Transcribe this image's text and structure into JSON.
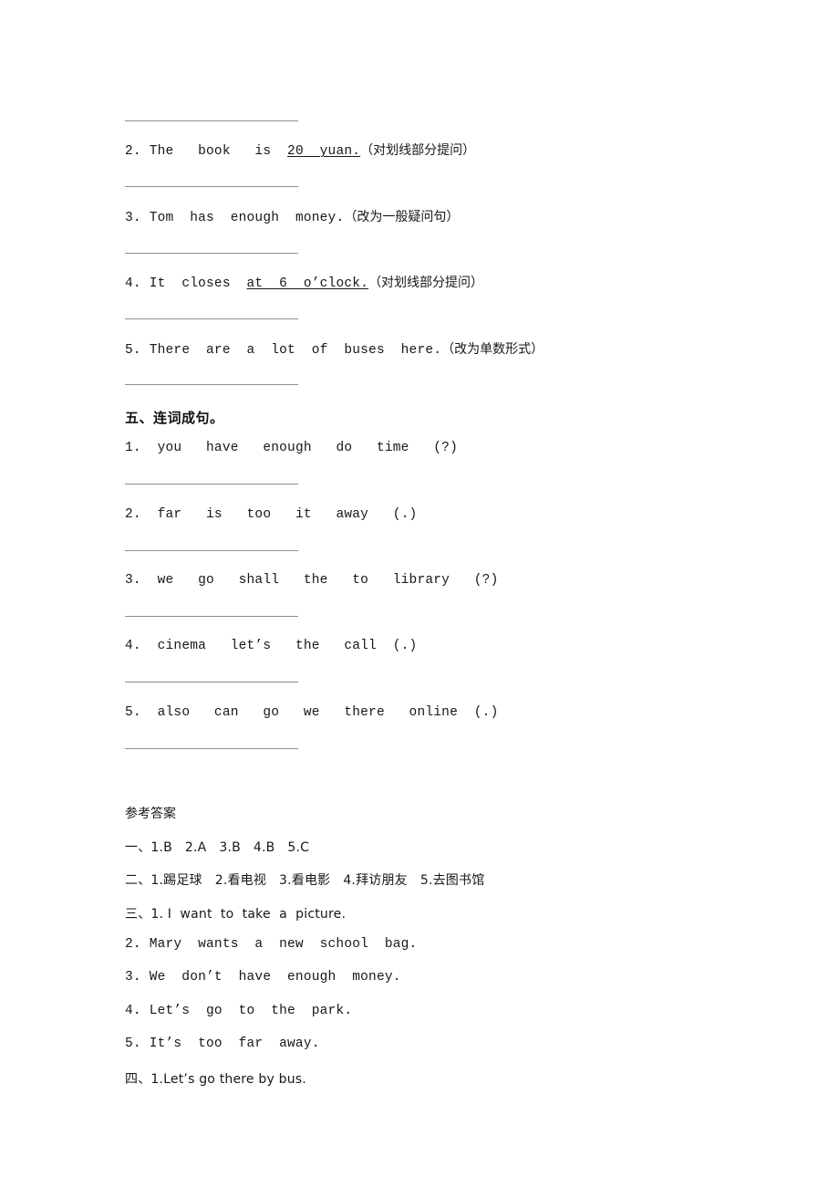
{
  "page": {
    "background": "#ffffff",
    "text_color": "#171717",
    "rule_color": "#8e8e8e"
  },
  "top_partial_blank": {
    "name": "answer-blank-rule"
  },
  "exercise_four_remaining": {
    "items": [
      {
        "number": "2.",
        "sentence_before": " The   book   is  ",
        "underlined": "20  yuan.",
        "instruction": "（对划线部分提问）"
      },
      {
        "number": "3.",
        "sentence_plain": " Tom  has  enough  money.",
        "instruction": "（改为一般疑问句）"
      },
      {
        "number": "4.",
        "sentence_before": " It  closes  ",
        "underlined": "at  6  o’clock.",
        "instruction": "（对划线部分提问）"
      },
      {
        "number": "5.",
        "sentence_plain": " There  are  a  lot  of  buses  here.",
        "instruction": "（改为单数形式）"
      }
    ]
  },
  "section_five": {
    "heading": "五、连词成句。",
    "items": [
      {
        "number": "1.",
        "words": "  you   have   enough   do   time   (?)"
      },
      {
        "number": "2.",
        "words": "  far   is   too   it   away   (.)"
      },
      {
        "number": "3.",
        "words": "  we   go   shall   the   to   library   (?)"
      },
      {
        "number": "4.",
        "words": "  cinema   let’s   the   call  (.)"
      },
      {
        "number": "5.",
        "words": "  also   can   go   we   there   online  (.)"
      }
    ]
  },
  "answers": {
    "heading": "参考答案",
    "lines": [
      {
        "id": "ans-1",
        "text": "一、1.B   2.A   3.B   4.B   5.C",
        "style": "mixed"
      },
      {
        "id": "ans-2",
        "text": "二、1.踢足球   2.看电视   3.看电影   4.拜访朋友   5.去图书馆",
        "style": "mixed"
      },
      {
        "id": "ans-3",
        "text": "三、1. I  want  to  take  a  picture.",
        "style": "mixed"
      },
      {
        "id": "ans-4",
        "text": "2. Mary  wants  a  new  school  bag.",
        "style": "mono"
      },
      {
        "id": "ans-5",
        "text": "3. We  don’t  have  enough  money.",
        "style": "mono"
      },
      {
        "id": "ans-6",
        "text": "4. Let’s  go  to  the  park.",
        "style": "mono"
      },
      {
        "id": "ans-7",
        "text": "5. It’s  too  far  away.",
        "style": "mono"
      },
      {
        "id": "ans-8",
        "text": "四、1.Let’s go there by bus.",
        "style": "mixed"
      }
    ]
  }
}
